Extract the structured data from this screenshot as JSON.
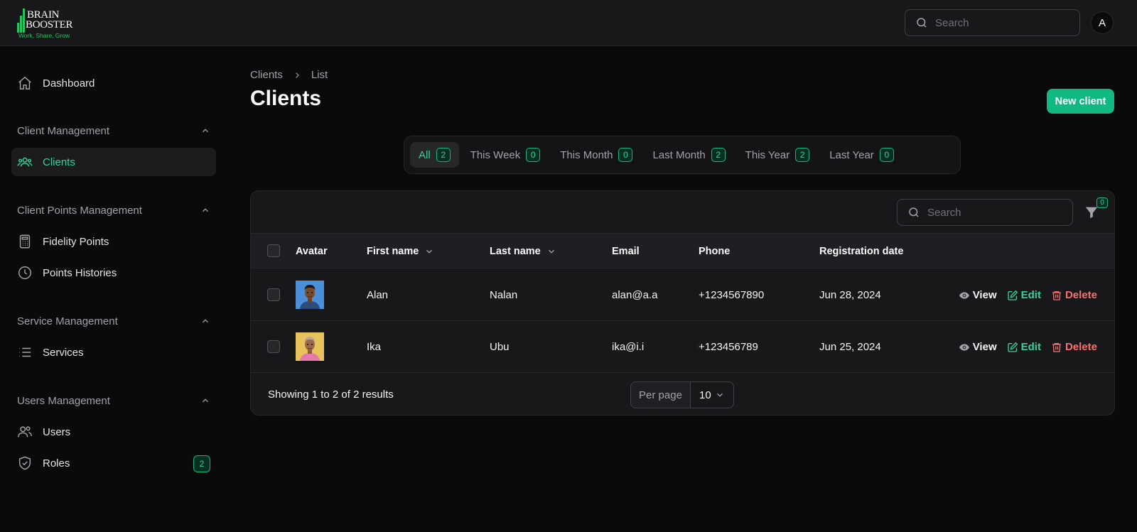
{
  "brand": {
    "name_line1": "BRAIN",
    "name_line2": "BOOSTER",
    "tagline": "Work, Share, Grow",
    "accent": "#22c55e"
  },
  "topbar": {
    "search_placeholder": "Search",
    "avatar_initial": "A"
  },
  "sidebar": {
    "dashboard": {
      "label": "Dashboard",
      "icon": "home-icon"
    },
    "groups": [
      {
        "label": "Client Management",
        "items": [
          {
            "label": "Clients",
            "icon": "users-group-icon",
            "active": true
          }
        ]
      },
      {
        "label": "Client Points Management",
        "items": [
          {
            "label": "Fidelity Points",
            "icon": "calculator-icon"
          },
          {
            "label": "Points Histories",
            "icon": "clock-icon"
          }
        ]
      },
      {
        "label": "Service Management",
        "items": [
          {
            "label": "Services",
            "icon": "list-icon"
          }
        ]
      },
      {
        "label": "Users Management",
        "items": [
          {
            "label": "Users",
            "icon": "users-icon"
          },
          {
            "label": "Roles",
            "icon": "shield-check-icon",
            "badge": "2"
          }
        ]
      }
    ]
  },
  "breadcrumb": {
    "parent": "Clients",
    "current": "List"
  },
  "page": {
    "title": "Clients",
    "new_button": "New client"
  },
  "tabs": [
    {
      "label": "All",
      "count": "2",
      "active": true
    },
    {
      "label": "This Week",
      "count": "0"
    },
    {
      "label": "This Month",
      "count": "0"
    },
    {
      "label": "Last Month",
      "count": "2"
    },
    {
      "label": "This Year",
      "count": "2"
    },
    {
      "label": "Last Year",
      "count": "0"
    }
  ],
  "table": {
    "search_placeholder": "Search",
    "filter_count": "0",
    "columns": {
      "avatar": "Avatar",
      "first_name": "First name",
      "last_name": "Last name",
      "email": "Email",
      "phone": "Phone",
      "registration": "Registration date"
    },
    "rows": [
      {
        "first_name": "Alan",
        "last_name": "Nalan",
        "email": "alan@a.a",
        "phone": "+1234567890",
        "registration": "Jun 28, 2024"
      },
      {
        "first_name": "Ika",
        "last_name": "Ubu",
        "email": "ika@i.i",
        "phone": "+123456789",
        "registration": "Jun 25, 2024"
      }
    ],
    "actions": {
      "view": "View",
      "edit": "Edit",
      "delete": "Delete"
    },
    "footer": {
      "showing": "Showing 1 to 2 of 2 results",
      "per_page_label": "Per page",
      "per_page_value": "10"
    }
  }
}
